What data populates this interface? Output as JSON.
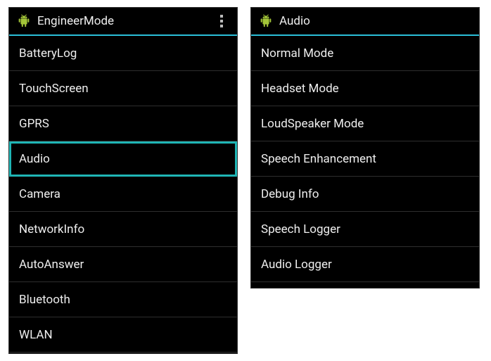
{
  "left": {
    "header": {
      "title": "EngineerMode"
    },
    "items": [
      {
        "label": "BatteryLog",
        "selected": false
      },
      {
        "label": "TouchScreen",
        "selected": false
      },
      {
        "label": "GPRS",
        "selected": false
      },
      {
        "label": "Audio",
        "selected": true
      },
      {
        "label": "Camera",
        "selected": false
      },
      {
        "label": "NetworkInfo",
        "selected": false
      },
      {
        "label": "AutoAnswer",
        "selected": false
      },
      {
        "label": "Bluetooth",
        "selected": false
      },
      {
        "label": "WLAN",
        "selected": false
      }
    ]
  },
  "right": {
    "header": {
      "title": "Audio"
    },
    "items": [
      {
        "label": "Normal Mode"
      },
      {
        "label": "Headset Mode"
      },
      {
        "label": "LoudSpeaker Mode"
      },
      {
        "label": "Speech Enhancement"
      },
      {
        "label": "Debug Info"
      },
      {
        "label": "Speech Logger"
      },
      {
        "label": "Audio Logger"
      }
    ]
  },
  "colors": {
    "accent": "#2bbed8",
    "selection": "#1fb5b5"
  }
}
